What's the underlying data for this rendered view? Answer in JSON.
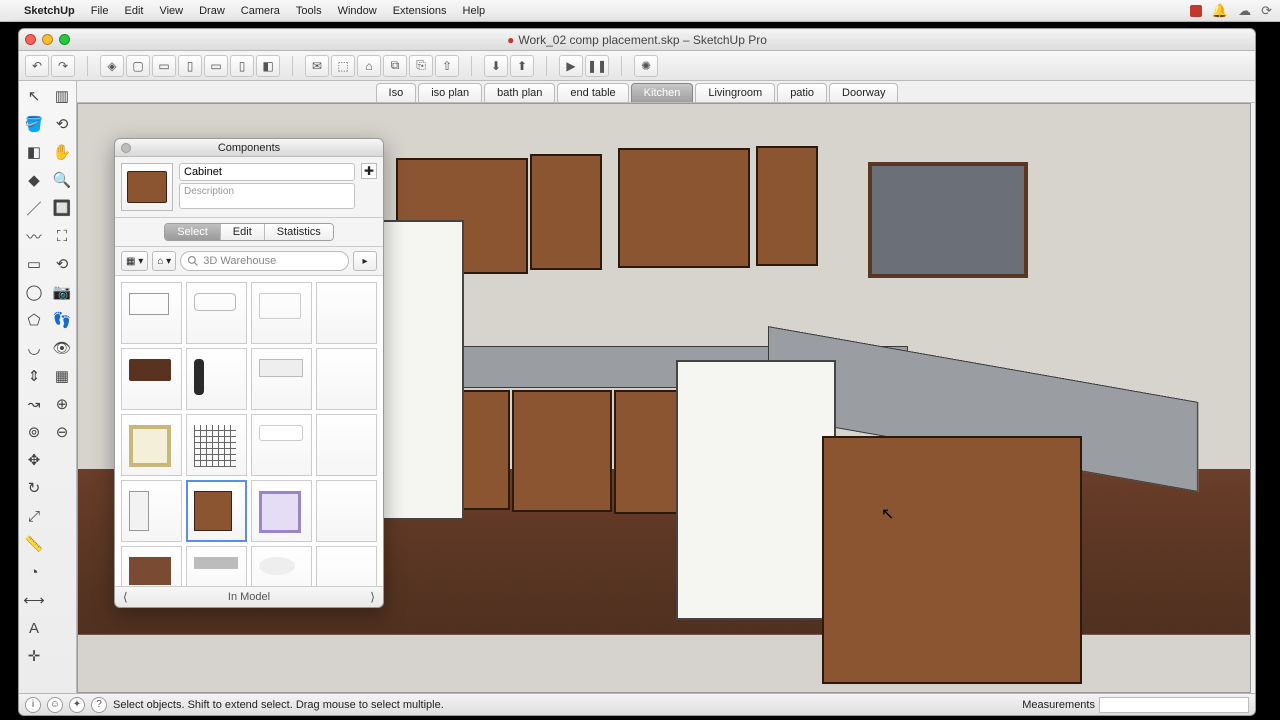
{
  "menubar": {
    "app": "SketchUp",
    "items": [
      "File",
      "Edit",
      "View",
      "Draw",
      "Camera",
      "Tools",
      "Window",
      "Extensions",
      "Help"
    ]
  },
  "window": {
    "title": "Work_02 comp placement.skp – SketchUp Pro"
  },
  "scenes": {
    "items": [
      "Iso",
      "iso plan",
      "bath plan",
      "end table",
      "Kitchen",
      "Livingroom",
      "patio",
      "Doorway"
    ],
    "selected": "Kitchen"
  },
  "components_panel": {
    "title": "Components",
    "name_value": "Cabinet",
    "description_placeholder": "Description",
    "tabs": [
      "Select",
      "Edit",
      "Statistics"
    ],
    "selected_tab": "Select",
    "search_placeholder": "3D Warehouse",
    "footer_label": "In Model",
    "items": [
      {
        "kind": "table",
        "selected": false
      },
      {
        "kind": "sofa",
        "selected": false
      },
      {
        "kind": "sectional",
        "selected": false
      },
      {
        "kind": "blank",
        "selected": false
      },
      {
        "kind": "coffee-table",
        "selected": false
      },
      {
        "kind": "person",
        "selected": false
      },
      {
        "kind": "bed",
        "selected": false
      },
      {
        "kind": "blank",
        "selected": false
      },
      {
        "kind": "frame",
        "selected": false
      },
      {
        "kind": "grid",
        "selected": false
      },
      {
        "kind": "mattress",
        "selected": false
      },
      {
        "kind": "blank",
        "selected": false
      },
      {
        "kind": "fridge",
        "selected": false
      },
      {
        "kind": "cabinet",
        "selected": true
      },
      {
        "kind": "rug",
        "selected": false
      },
      {
        "kind": "blank",
        "selected": false
      },
      {
        "kind": "brick",
        "selected": false
      },
      {
        "kind": "countertop",
        "selected": false
      },
      {
        "kind": "sink",
        "selected": false
      },
      {
        "kind": "blank",
        "selected": false
      }
    ]
  },
  "status": {
    "hint": "Select objects. Shift to extend select. Drag mouse to select multiple.",
    "measurements_label": "Measurements"
  },
  "toolbar": {
    "groups": [
      [
        "undo",
        "redo"
      ],
      [
        "view-iso",
        "view-top",
        "view-front",
        "view-right",
        "view-back",
        "view-left",
        "view-persp"
      ],
      [
        "layer-new",
        "layer-model",
        "layer-home",
        "layer-copy",
        "layer-paste",
        "layer-up"
      ],
      [
        "warehouse-get",
        "warehouse-share"
      ],
      [
        "play",
        "pause"
      ],
      [
        "extensions"
      ]
    ]
  },
  "toolbox": {
    "tools": [
      "select",
      "paint-bucket",
      "eraser",
      "material",
      "line",
      "freehand",
      "rectangle",
      "circle",
      "polygon",
      "arc",
      "pushpull",
      "followme",
      "offset",
      "move",
      "rotate",
      "scale",
      "tape",
      "protractor",
      "dimensions",
      "text",
      "axes",
      "section",
      "orbit",
      "pan",
      "zoom",
      "zoom-window",
      "zoom-extents",
      "previous",
      "position-camera",
      "walk",
      "lookaround",
      "sandbox",
      "solid-union",
      "solid-subtract"
    ]
  }
}
